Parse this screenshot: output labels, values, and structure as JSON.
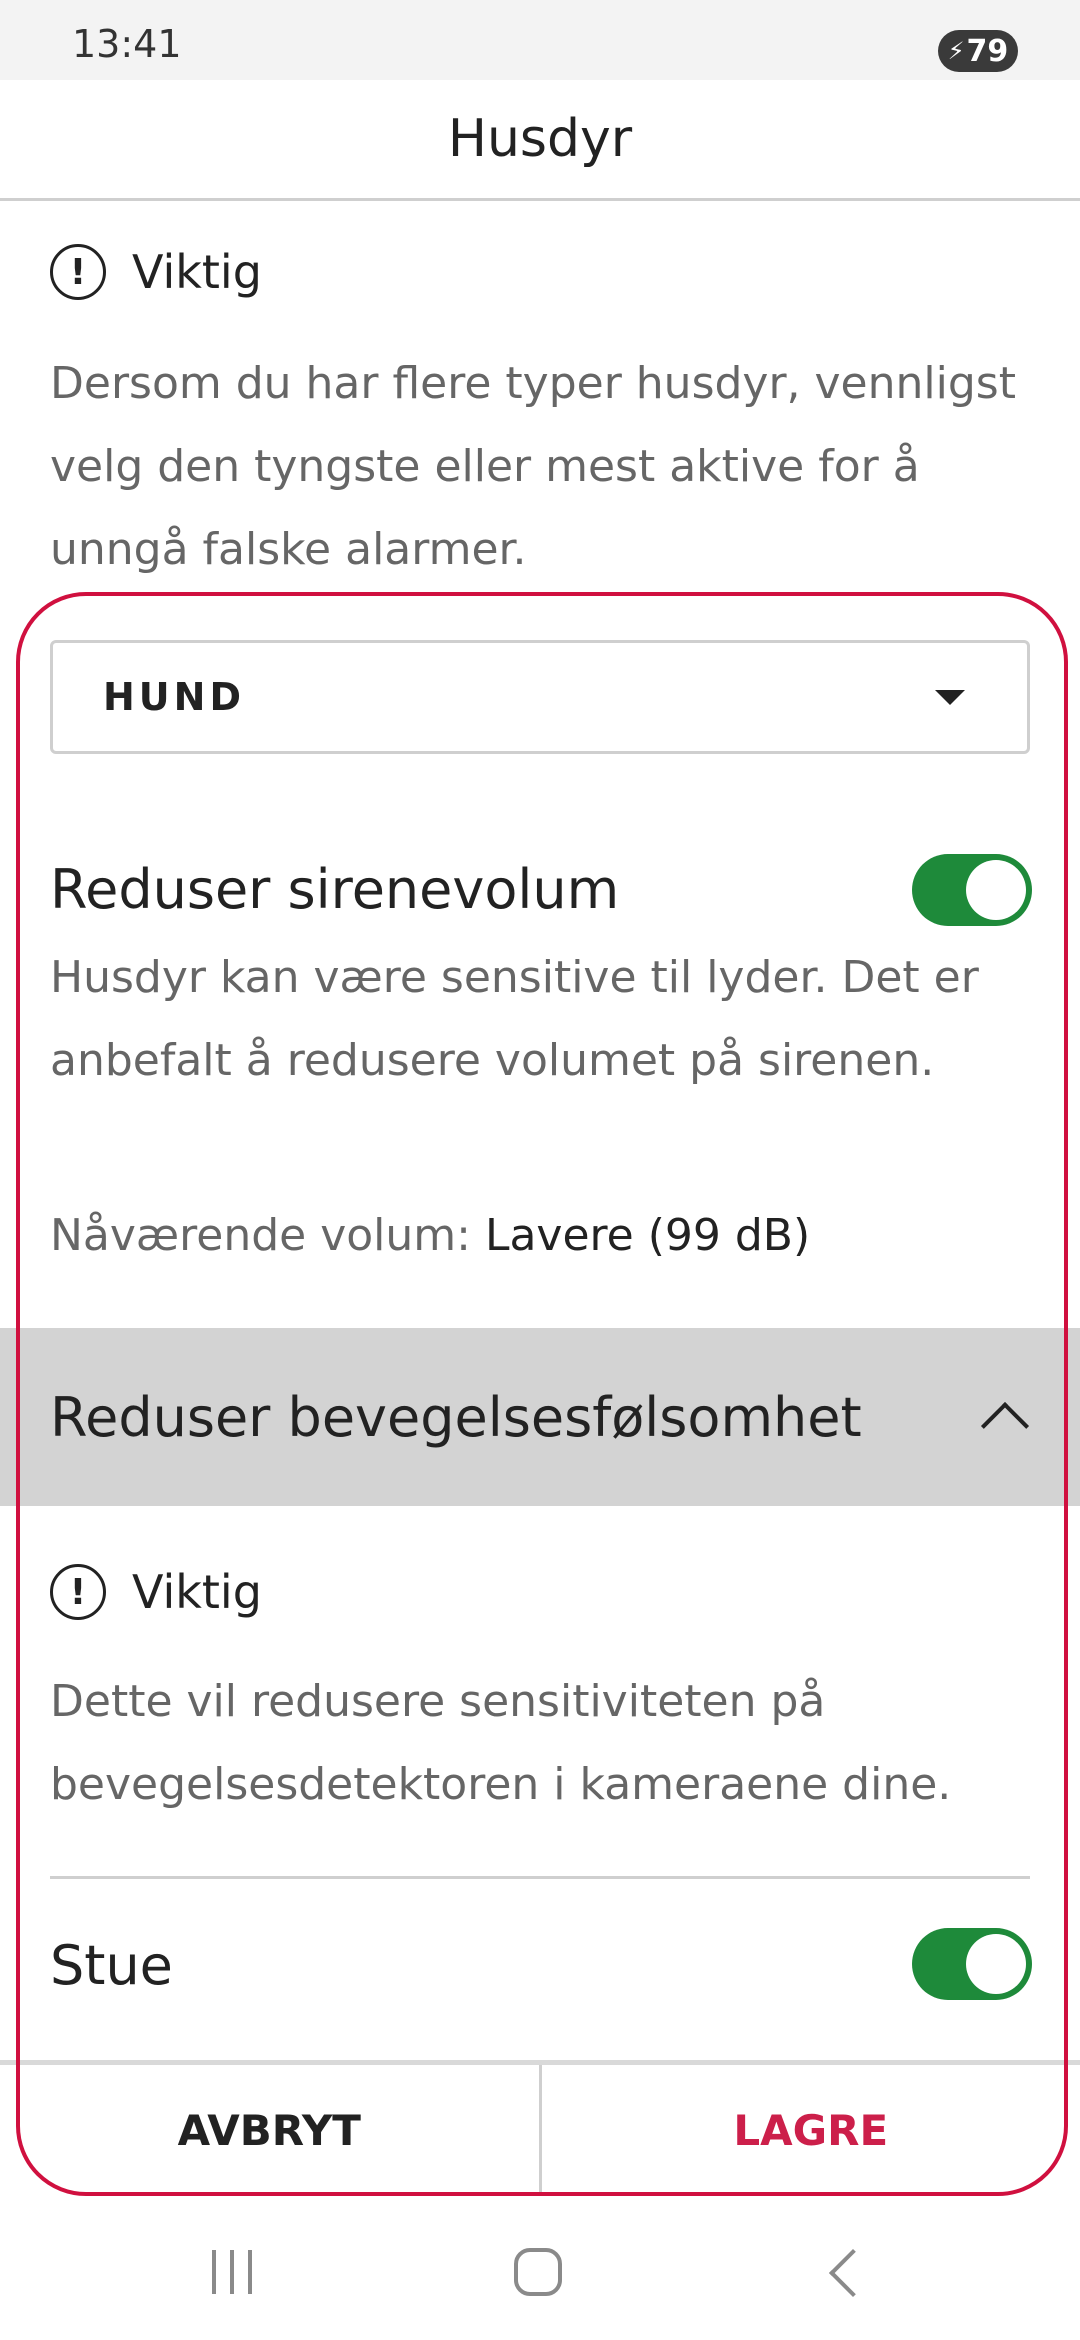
{
  "status_bar": {
    "time": "13:41",
    "battery": "79"
  },
  "header": {
    "title": "Husdyr"
  },
  "info_1": {
    "label": "Viktig",
    "text": "Dersom du har flere typer husdyr, vennligst velg den tyngste eller mest aktive for å unngå falske alarmer."
  },
  "pet_select": {
    "value": "HUND"
  },
  "siren": {
    "title": "Reduser sirenevolum",
    "enabled": true,
    "description": "Husdyr kan være sensitive til lyder. Det er anbefalt å redusere volumet på sirenen.",
    "volume_label": "Nåværende volum:",
    "volume_value": "Lavere (99 dB)"
  },
  "motion": {
    "title": "Reduser bevegelsesfølsomhet",
    "info_label": "Viktig",
    "info_text": "Dette vil redusere sensitiviteten på bevegelsesdetektoren i kameraene dine.",
    "rooms": [
      {
        "name": "Stue",
        "enabled": true
      }
    ]
  },
  "actions": {
    "cancel": "AVBRYT",
    "save": "LAGRE"
  },
  "colors": {
    "accent": "#cc1f4a",
    "toggle_on": "#1e8a3a",
    "section_bg": "#d3d3d3"
  }
}
